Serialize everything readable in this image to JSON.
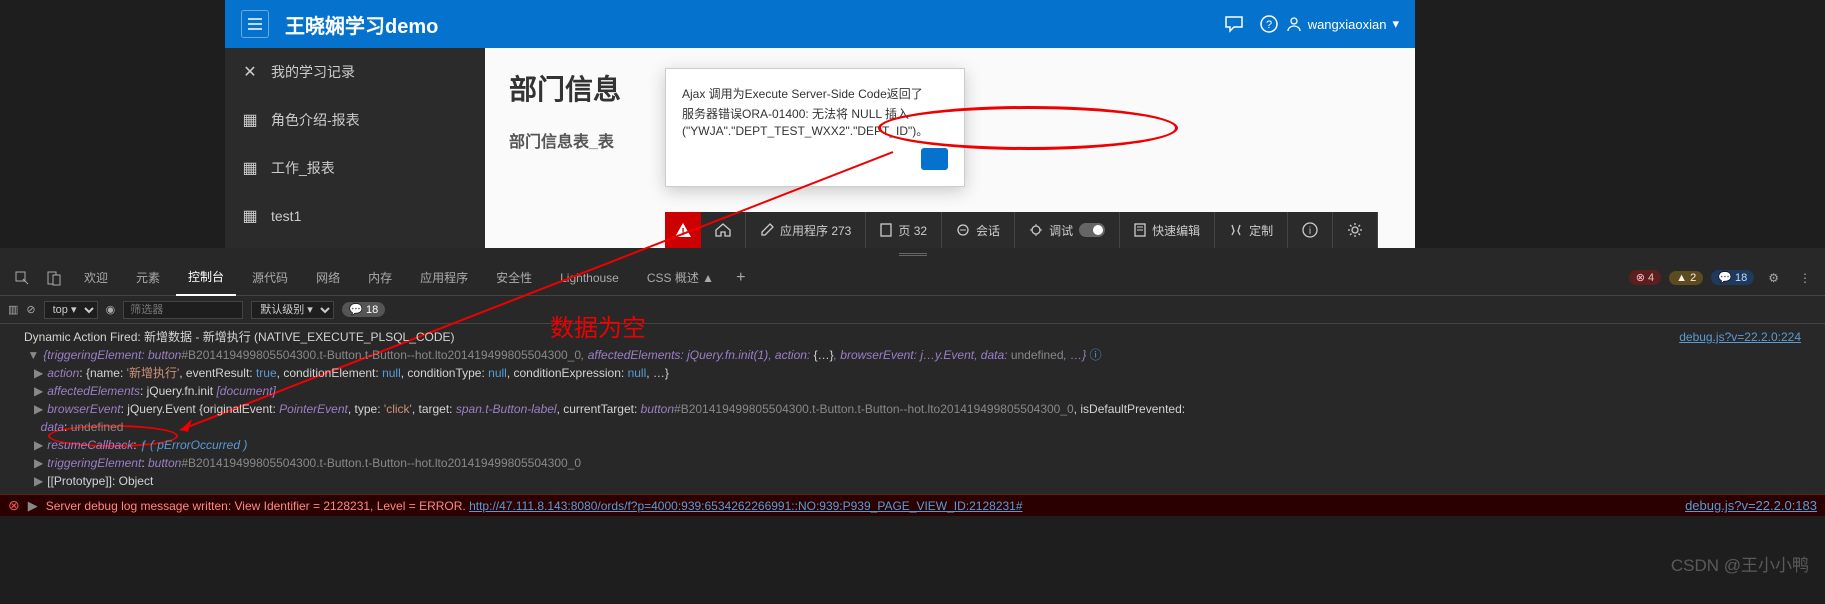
{
  "header": {
    "title": "王晓娴学习demo",
    "user": "wangxiaoxian",
    "icons": {
      "hamburger": "≡",
      "chat": "chat",
      "help": "?",
      "user_dropdown": "▾"
    }
  },
  "sidebar": {
    "items": [
      {
        "icon": "✕",
        "label": "我的学习记录"
      },
      {
        "icon": "▦",
        "label": "角色介绍-报表"
      },
      {
        "icon": "▦↓",
        "label": "工作_报表"
      },
      {
        "icon": "▦↓",
        "label": "test1"
      }
    ]
  },
  "content": {
    "title": "部门信息",
    "subtitle": "部门信息表_表"
  },
  "modal": {
    "title_line": "Ajax 调用为Execute Server-Side Code返回了",
    "body": "服务器错误ORA-01400: 无法将 NULL 插入 (\"YWJA\".\"DEPT_TEST_WXX2\".\"DEPT_ID\")。"
  },
  "dev_toolbar": {
    "warn_icon": "⚠",
    "home_icon": "⌂",
    "app_label": "应用程序 273",
    "page_label": "页 32",
    "session_label": "会话",
    "debug_label": "调试",
    "quick_edit_label": "快速编辑",
    "customize_label": "定制",
    "info_icon": "ⓘ",
    "gear_icon": "⚙"
  },
  "devtools": {
    "tabs": [
      "欢迎",
      "元素",
      "控制台",
      "源代码",
      "网络",
      "内存",
      "应用程序",
      "安全性",
      "Lighthouse",
      "CSS 概述 ▲"
    ],
    "active_tab": 2,
    "badges": {
      "errors": "4",
      "warnings": "2",
      "info": "18"
    },
    "filter": {
      "context": "top ▾",
      "filter_placeholder": "筛选器",
      "level": "默认级别 ▾",
      "hidden_count": "18"
    },
    "annotation_text": "数据为空",
    "console_lines": {
      "title": "Dynamic Action Fired: 新增数据 - 新增执行 (NATIVE_EXECUTE_PLSQL_CODE)",
      "file_link_1": "debug.js?v=22.2.0:224",
      "obj_preview": "{triggeringElement: button#B201419499805504300.t-Button.t-Button--hot.lto201419499805504300_0, affectedElements: jQuery.fn.init(1), action: {…}, browserEvent: j…y.Event, data: undefined, …}",
      "action": "action: {name: '新增执行', eventResult: true, conditionElement: null, conditionType: null, conditionExpression: null, …}",
      "affected": "affectedElements: jQuery.fn.init [document]",
      "browser_event": "browserEvent: jQuery.Event {originalEvent: PointerEvent, type: 'click', target: span.t-Button-label, currentTarget: button#B201419499805504300.t-Button.t-Button--hot.lto201419499805504300_0, isDefaultPrevented:",
      "data_line": "data: undefined",
      "resume": "resumeCallback: ƒ ( pErrorOccurred )",
      "triggering": "triggeringElement: button#B201419499805504300.t-Button.t-Button--hot.lto201419499805504300_0",
      "proto": "[[Prototype]]: Object"
    },
    "error_line": {
      "prefix": "Server debug log message written: View Identifier = 2128231, Level = ERROR. ",
      "url": "http://47.111.8.143:8080/ords/f?p=4000:939:6534262266991::NO:939:P939_PAGE_VIEW_ID:2128231#",
      "file_link": "debug.js?v=22.2.0:183"
    }
  },
  "signature": "CSDN @王小小鸭"
}
